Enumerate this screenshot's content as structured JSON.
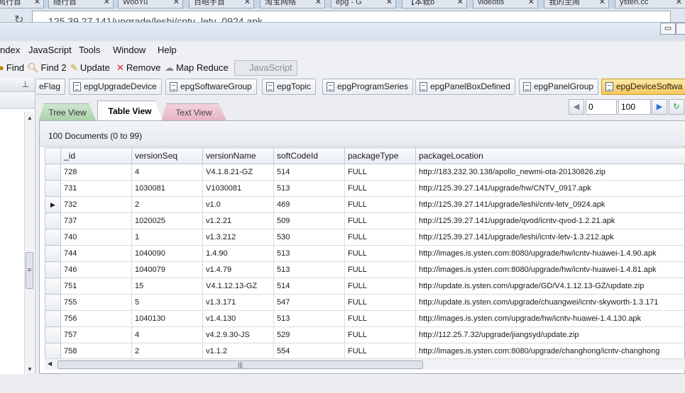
{
  "browser": {
    "tabs": [
      "阅行首",
      "随行首",
      "WooYu",
      "百晤宇首",
      "淘宝网络",
      "epg - G",
      "【本栽b",
      "videotis",
      "我的至闹",
      "ysten.cc"
    ],
    "url": "125.39.27.141/upgrade/leshi/cntv_letv_0924.apk"
  },
  "menu": [
    "ndex",
    "JavaScript",
    "Tools",
    "Window",
    "Help"
  ],
  "toolbar": {
    "find": "Find",
    "find2": "Find 2",
    "update": "Update",
    "remove": "Remove",
    "map_reduce": "Map Reduce",
    "javascript": "JavaScript"
  },
  "collections": [
    "eFlag",
    "epgUpgradeDevice",
    "epgSoftwareGroup",
    "epgTopic",
    "epgProgramSeries",
    "epgPanelBoxDefined",
    "epgPanelGroup",
    "epgDeviceSoftwa"
  ],
  "views": {
    "tree": "Tree View",
    "table": "Table View",
    "text": "Text View"
  },
  "pager": {
    "skip": "0",
    "limit": "100"
  },
  "doc_count": "100 Documents (0 to 99)",
  "columns": [
    "_id",
    "versionSeq",
    "versionName",
    "softCodeId",
    "packageType",
    "packageLocation"
  ],
  "rows": [
    [
      "728",
      "4",
      "V4.1.8.21-GZ",
      "514",
      "FULL",
      "http://183.232.30.138/apollo_newmi-ota-20130826.zip"
    ],
    [
      "731",
      "1030081",
      "V1030081",
      "513",
      "FULL",
      "http://125.39.27.141/upgrade/hw/CNTV_0917.apk"
    ],
    [
      "732",
      "2",
      "v1.0",
      "469",
      "FULL",
      "http://125.39.27.141/upgrade/leshi/cntv-letv_0924.apk"
    ],
    [
      "737",
      "1020025",
      "v1.2.21",
      "509",
      "FULL",
      "http://125.39.27.141/upgrade/qvod/icntv-qvod-1.2.21.apk"
    ],
    [
      "740",
      "1",
      "v1.3.212",
      "530",
      "FULL",
      "http://125.39.27.141/upgrade/leshi/icntv-letv-1.3.212.apk"
    ],
    [
      "744",
      "1040090",
      "1.4.90",
      "513",
      "FULL",
      "http://images.is.ysten.com:8080/upgrade/hw/icntv-huawei-1.4.90.apk"
    ],
    [
      "746",
      "1040079",
      "v1.4.79",
      "513",
      "FULL",
      "http://images.is.ysten.com:8080/upgrade/hw/icntv-huawei-1.4.81.apk"
    ],
    [
      "751",
      "15",
      "V4.1.12.13-GZ",
      "514",
      "FULL",
      "http://update.is.ysten.com/upgrade/GD/V4.1.12.13-GZ/update.zip"
    ],
    [
      "755",
      "5",
      "v1.3.171",
      "547",
      "FULL",
      "http://update.is.ysten.com/upgrade/chuangwei/icntv-skyworth-1.3.171"
    ],
    [
      "756",
      "1040130",
      "v1.4.130",
      "513",
      "FULL",
      "http://images.is.ysten.com/upgrade/hw/icntv-huawei-1.4.130.apk"
    ],
    [
      "757",
      "4",
      "v4.2.9.30-JS",
      "529",
      "FULL",
      "http://112.25.7.32/upgrade/jiangsyd/update.zip"
    ],
    [
      "758",
      "2",
      "v1.1.2",
      "554",
      "FULL",
      "http://images.is.ysten.com:8080/upgrade/changhong/icntv-changhong"
    ]
  ],
  "current_row_marker": "▶",
  "colors": {
    "active_tab": "#f7c85b",
    "tree_tab": "#a9d0a9",
    "text_tab": "#e7b4c6"
  }
}
